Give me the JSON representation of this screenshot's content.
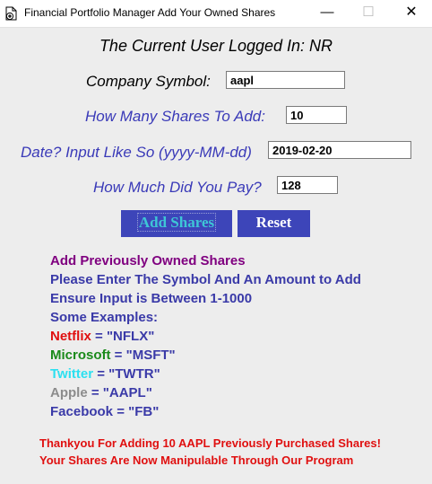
{
  "window": {
    "title": "Financial Portfolio Manager Add Your Owned Shares",
    "minimize_glyph": "—",
    "maximize_glyph": "☐",
    "close_glyph": "✕"
  },
  "header": {
    "logged_in": "The Current User Logged In: NR"
  },
  "form": {
    "symbol_label": "Company Symbol:",
    "symbol_value": "aapl",
    "shares_label": "How Many Shares To Add:",
    "shares_value": "10",
    "date_label": "Date? Input Like So (yyyy-MM-dd)",
    "date_value": "2019-02-20",
    "price_label": "How Much Did You Pay?",
    "price_value": "128"
  },
  "buttons": {
    "add": "Add Shares",
    "reset": "Reset"
  },
  "info": {
    "heading": "Add Previously Owned Shares",
    "line1": "Please Enter The Symbol And An Amount to Add",
    "line2": "Ensure Input is Between 1-1000",
    "line3": "Some Examples:",
    "examples": [
      {
        "name": "Netflix",
        "symbol": " = \"NFLX\""
      },
      {
        "name": "Microsoft",
        "symbol": " = \"MSFT\""
      },
      {
        "name": "Twitter",
        "symbol": " = \"TWTR\""
      },
      {
        "name": "Apple",
        "symbol": " = \"AAPL\""
      },
      {
        "name": "Facebook",
        "symbol": " = \"FB\""
      }
    ]
  },
  "status": {
    "line1": "Thankyou For Adding 10 AAPL Previously Purchased Shares!",
    "line2": "Your Shares Are Now Manipulable Through Our Program"
  },
  "colors": {
    "background": "#ededed",
    "button": "#3d45b9",
    "label_blue": "#3a3ab8",
    "heading_purple": "#800080",
    "message_red": "#e01010"
  },
  "icons": {
    "app": "document-plus-icon"
  }
}
